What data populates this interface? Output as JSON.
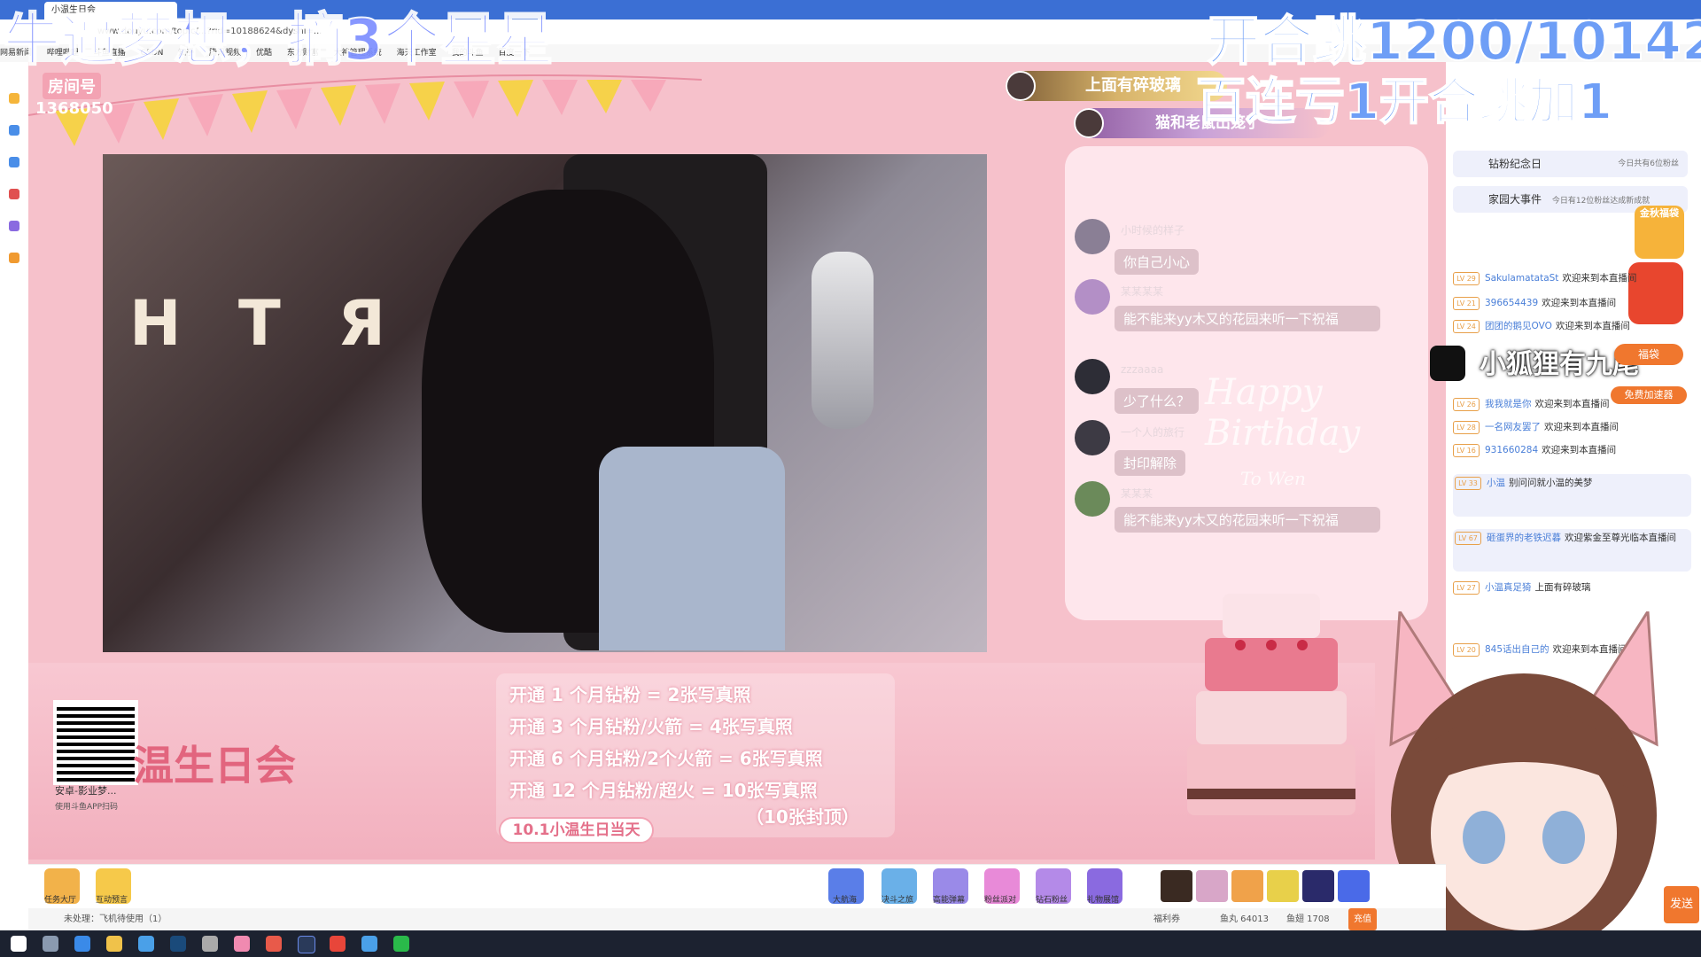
{
  "browser": {
    "tab_title": "小温生日会",
    "url": "www.douyu.com/topic/...?rid=10188624&dyshi=...",
    "bookmarks": [
      "网易新闻",
      "哔哩哔哩",
      "斗鱼直播",
      "CSDN",
      "知乎",
      "腾讯视频",
      "优酷",
      "东方财富",
      "大神管理系统",
      "海天工作室",
      "我的斗鱼",
      "百度一下"
    ]
  },
  "overlays": {
    "top_left": "牛逼梦想，摘3个星星",
    "top_right_1": "开合跳1200/10142",
    "top_right_2": "百连亏1开合跳加1"
  },
  "stream": {
    "room_label": "房间号",
    "room_number": "1368050",
    "video_letters": "H T Я",
    "notice_1": "上面有碎玻璃",
    "notice_2": "猫和老鼠出笼了"
  },
  "chat": [
    {
      "name": "小时候的样子",
      "message": "你自己小心"
    },
    {
      "name": "某某某某",
      "message": "能不能来yy木又的花园来听一下祝福"
    },
    {
      "name": "zzzaaaa",
      "message": "少了什么？"
    },
    {
      "name": "一个人的旅行",
      "message": "封印解除"
    },
    {
      "name": "某某某",
      "message": "能不能来yy木又的花园来听一下祝福"
    }
  ],
  "birthday_art": {
    "happy": "Happy",
    "birthday": "Birthday",
    "to": "To Wen"
  },
  "banner": {
    "qr_caption": "安卓-影业梦...",
    "qr_subcaption": "使用斗鱼APP扫码",
    "title": "温生日会",
    "rules": [
      "开通 1 个月钻粉  =  2张写真照",
      "开通 3 个月钻粉/火箭 = 4张写真照",
      "开通 6 个月钻粉/2个火箭 = 6张写真照",
      "开通 12 个月钻粉/超火 = 10张写真照"
    ],
    "rule_cap": "（10张封顶）",
    "date_pill": "10.1小温生日当天"
  },
  "toolbar": {
    "left": [
      "任务大厅",
      "互动预言"
    ],
    "right": [
      "大航海",
      "决斗之旅",
      "高能弹幕",
      "粉丝派对",
      "钻石粉丝",
      "礼物展馆"
    ],
    "status_pending": "未处理：飞机待使用（1）",
    "status_right": [
      "福利券",
      "鱼丸 64013",
      "鱼翅 1708",
      "充值"
    ]
  },
  "sidebar": {
    "card_anniv": {
      "label": "钻粉纪念日",
      "note": "今日共有6位粉丝"
    },
    "card_family": {
      "label": "家园大事件",
      "note": "今日有12位粉丝达成新成就"
    },
    "gift_tag": "金秋福袋",
    "fox_text": "小狐狸有九尾",
    "speed_tag": "免费加速器",
    "fan_bag": "福袋",
    "danmu": [
      {
        "lv": "LV 29",
        "user": "SakulamatataSt",
        "msg": "欢迎来到本直播间"
      },
      {
        "lv": "LV 21",
        "user": "396654439",
        "msg": "欢迎来到本直播间"
      },
      {
        "lv": "LV 24",
        "user": "团团的鹅见OVO",
        "msg": "欢迎来到本直播间"
      },
      {
        "lv": "LV 26",
        "user": "我我就是你",
        "msg": "欢迎来到本直播间"
      },
      {
        "lv": "LV 28",
        "user": "一名网友罢了",
        "msg": "欢迎来到本直播间"
      },
      {
        "lv": "LV 16",
        "user": "931660284",
        "msg": "欢迎来到本直播间"
      },
      {
        "lv": "LV 33",
        "user": "小温",
        "msg": "别问问就小温的美梦"
      },
      {
        "lv": "LV 67",
        "user": "砸蛋界的老铁迟暮",
        "msg": "欢迎紫金至尊光临本直播间"
      },
      {
        "lv": "LV 27",
        "user": "小温真足猗",
        "msg": "上面有碎玻璃"
      },
      {
        "lv": "LV 20",
        "user": "845话出自己的",
        "msg": "欢迎来到本直播间"
      }
    ],
    "send_label": "发送"
  },
  "colors": {
    "accent_pink": "#f2a3b4",
    "douyu_orange": "#f0772e",
    "overlay_blue": "#6e9ef6"
  }
}
